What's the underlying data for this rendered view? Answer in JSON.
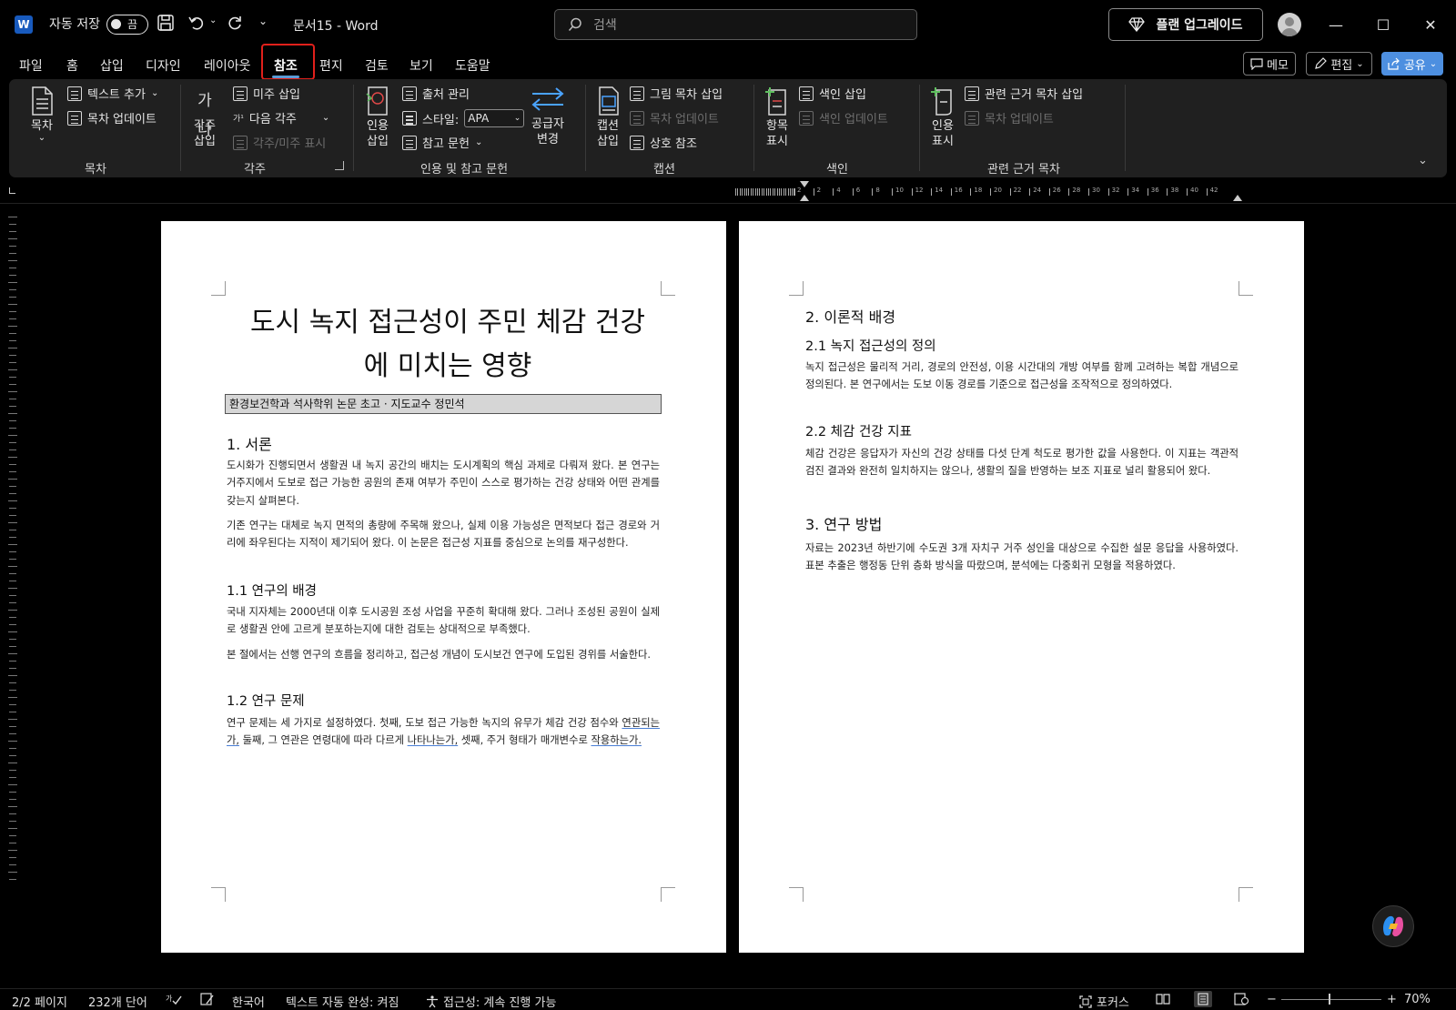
{
  "titlebar": {
    "app_logo": "W",
    "autosave_label": "자동 저장",
    "autosave_state": "끔",
    "doc_name": "문서15 - Word",
    "search_placeholder": "검색",
    "upgrade_label": "플랜 업그레이드",
    "minimize": "—",
    "maximize": "☐",
    "close": "✕"
  },
  "menu": {
    "tabs": [
      "파일",
      "홈",
      "삽입",
      "디자인",
      "레이아웃",
      "참조",
      "편지",
      "검토",
      "보기",
      "도움말"
    ],
    "memo_label": "메모",
    "edit_label": "편집",
    "share_label": "공유"
  },
  "ribbon": {
    "groups": {
      "toc": "목차",
      "footnotes": "각주",
      "citations": "인용 및 참고 문헌",
      "captions": "캡션",
      "index": "색인",
      "authorities": "관련 근거 목차"
    },
    "toc": {
      "big": "목차",
      "add_text": "텍스트 추가",
      "update": "목차 업데이트"
    },
    "footnotes": {
      "big_line1": "각주",
      "big_line2": "삽입",
      "big_glyph": "가나",
      "insert_endnote": "미주 삽입",
      "next_footnote": "다음 각주",
      "show_notes": "각주/미주 표시"
    },
    "citations": {
      "big_line1": "인용",
      "big_line2": "삽입",
      "manage_sources": "출처 관리",
      "style_label": "스타일:",
      "style_value": "APA",
      "bibliography": "참고 문헌",
      "swap_line1": "공급자",
      "swap_line2": "변경"
    },
    "captions": {
      "big_line1": "캡션",
      "big_line2": "삽입",
      "insert_tof": "그림 목차 삽입",
      "update_table": "목차 업데이트",
      "cross_ref": "상호 참조"
    },
    "index": {
      "big_line1": "항목",
      "big_line2": "표시",
      "insert_index": "색인 삽입",
      "update_index": "색인 업데이트"
    },
    "authorities": {
      "big_line1": "인용",
      "big_line2": "표시",
      "insert_toa": "관련 근거 목차 삽입",
      "update_table": "목차 업데이트"
    }
  },
  "ruler": {
    "labels": [
      "2",
      "2",
      "4",
      "6",
      "8",
      "10",
      "12",
      "14",
      "16",
      "18",
      "20",
      "22",
      "24",
      "26",
      "28",
      "30",
      "32",
      "34",
      "36",
      "38",
      "40",
      "42"
    ]
  },
  "page1": {
    "title_line1": "도시 녹지 접근성이 주민 체감 건강",
    "title_line2": "에 미치는 영향",
    "subtitle": "환경보건학과 석사학위 논문 초고 · 지도교수 정민석",
    "h1_intro": "1. 서론",
    "p1": "도시화가 진행되면서 생활권 내 녹지 공간의 배치는 도시계획의 핵심 과제로 다뤄져 왔다. 본 연구는 거주지에서 도보로 접근 가능한 공원의 존재 여부가 주민이 스스로 평가하는 건강 상태와 어떤 관계를 갖는지 살펴본다.",
    "p2": "기존 연구는 대체로 녹지 면적의 총량에 주목해 왔으나, 실제 이용 가능성은 면적보다 접근 경로와 거리에 좌우된다는 지적이 제기되어 왔다. 이 논문은 접근성 지표를 중심으로 논의를 재구성한다.",
    "h2_background": "1.1 연구의 배경",
    "p3": "국내 지자체는 2000년대 이후 도시공원 조성 사업을 꾸준히 확대해 왔다. 그러나 조성된 공원이 실제로 생활권 안에 고르게 분포하는지에 대한 검토는 상대적으로 부족했다.",
    "p4": "본 절에서는 선행 연구의 흐름을 정리하고, 접근성 개념이 도시보건 연구에 도입된 경위를 서술한다.",
    "h2_problem": "1.2 연구 문제",
    "p5_a": "연구 문제는 세 가지로 설정하였다. 첫째, 도보 접근 가능한 녹지의 유무가 체감 건강 점수와 ",
    "p5_u1": "연관되는가,",
    "p5_b": " 둘째, 그 연관은 연령대에 따라 다르게 ",
    "p5_u2": "나타나는가,",
    "p5_c": " 셋째, 주거 형태가 매개변수로 ",
    "p5_u3": "작용하는가."
  },
  "page2": {
    "h1_theory": "2. 이론적 배경",
    "h2_def": "2.1 녹지 접근성의 정의",
    "p1": "녹지 접근성은 물리적 거리, 경로의 안전성, 이용 시간대의 개방 여부를 함께 고려하는 복합 개념으로 정의된다. 본 연구에서는 도보 이동 경로를 기준으로 접근성을 조작적으로 정의하였다.",
    "h2_health": "2.2 체감 건강 지표",
    "p2": "체감 건강은 응답자가 자신의 건강 상태를 다섯 단계 척도로 평가한 값을 사용한다. 이 지표는 객관적 검진 결과와 완전히 일치하지는 않으나, 생활의 질을 반영하는 보조 지표로 널리 활용되어 왔다.",
    "h1_method": "3. 연구 방법",
    "p3": "자료는 2023년 하반기에 수도권 3개 자치구 거주 성인을 대상으로 수집한 설문 응답을 사용하였다. 표본 추출은 행정동 단위 층화 방식을 따랐으며, 분석에는 다중회귀 모형을 적용하였다."
  },
  "statusbar": {
    "page": "2/2 페이지",
    "words": "232개 단어",
    "language": "한국어",
    "autocomplete": "텍스트 자동 완성: 켜짐",
    "accessibility": "접근성: 계속 진행 가능",
    "focus": "포커스",
    "zoom": "70%"
  },
  "colors": {
    "accent": "#4d8fe0",
    "highlight_box": "#e0201b",
    "ribbon_bg": "#202020"
  }
}
